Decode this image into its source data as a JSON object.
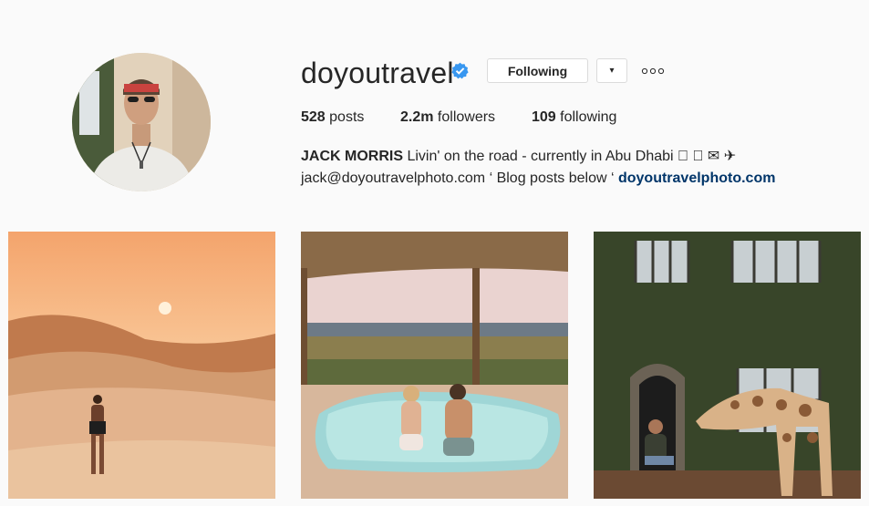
{
  "profile": {
    "username": "doyoutravel",
    "follow_button": "Following",
    "dropdown_glyph": "▾",
    "stats": {
      "posts_count": "528",
      "posts_label": "posts",
      "followers_count": "2.2m",
      "followers_label": "followers",
      "following_count": "109",
      "following_label": "following"
    },
    "bio": {
      "full_name": "JACK MORRIS",
      "line1_text": "Livin' on the road - currently in Abu Dhabi ⃞ ⃞ ✉ ✈",
      "line2_text": "jack@doyoutravelphoto.com ‘ Blog posts below ‘ ",
      "link": "doyoutravelphoto.com"
    }
  },
  "icons": [
    "verified-badge-icon",
    "chevron-down-icon",
    "more-options-icon"
  ],
  "colors": {
    "background": "#fafafa",
    "verified": "#3897f0",
    "link": "#003569",
    "border": "#dbdbdb"
  }
}
